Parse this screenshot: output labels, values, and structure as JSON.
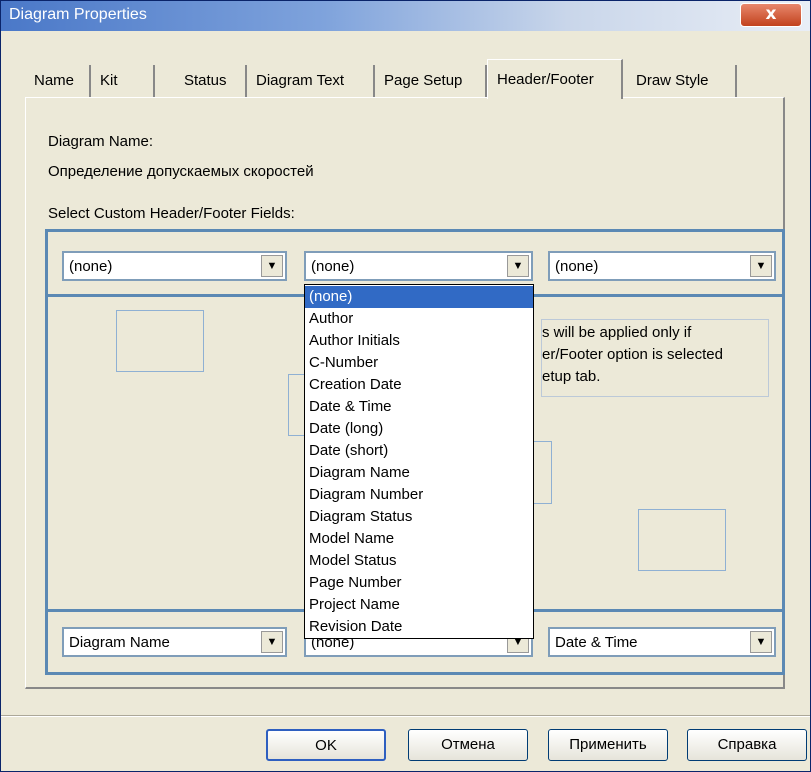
{
  "window": {
    "title": "Diagram Properties",
    "close_glyph": "x"
  },
  "tabs": [
    {
      "label": "Name"
    },
    {
      "label": "Kit"
    },
    {
      "label": "Status"
    },
    {
      "label": "Diagram Text"
    },
    {
      "label": "Page Setup"
    },
    {
      "label": "Header/Footer"
    },
    {
      "label": "Draw Style"
    }
  ],
  "active_tab": "Header/Footer",
  "diagram_name_label": "Diagram Name:",
  "diagram_name_value": "Определение допускаемых скоростей",
  "select_fields_label": "Select Custom Header/Footer Fields:",
  "header": {
    "left": "(none)",
    "center": "(none)",
    "right": "(none)"
  },
  "footer": {
    "left": "Diagram Name",
    "center": "(none)",
    "right": "Date & Time"
  },
  "note_lines": [
    "s will be applied only if",
    "er/Footer option is selected",
    "etup tab."
  ],
  "dropdown": {
    "selected": "(none)",
    "options": [
      "(none)",
      "Author",
      "Author Initials",
      "C-Number",
      "Creation Date",
      "Date & Time",
      "Date (long)",
      "Date (short)",
      "Diagram Name",
      "Diagram Number",
      "Diagram Status",
      "Model Name",
      "Model Status",
      "Page Number",
      "Project Name",
      "Revision Date"
    ]
  },
  "buttons": {
    "ok": "OK",
    "cancel": "Отмена",
    "apply": "Применить",
    "help": "Справка"
  },
  "icons": {
    "combo_arrow": "▼",
    "close": "close-icon"
  },
  "colors": {
    "frame": "#5b89b4",
    "selection": "#316ac5",
    "dialog_bg": "#ece9d8"
  }
}
